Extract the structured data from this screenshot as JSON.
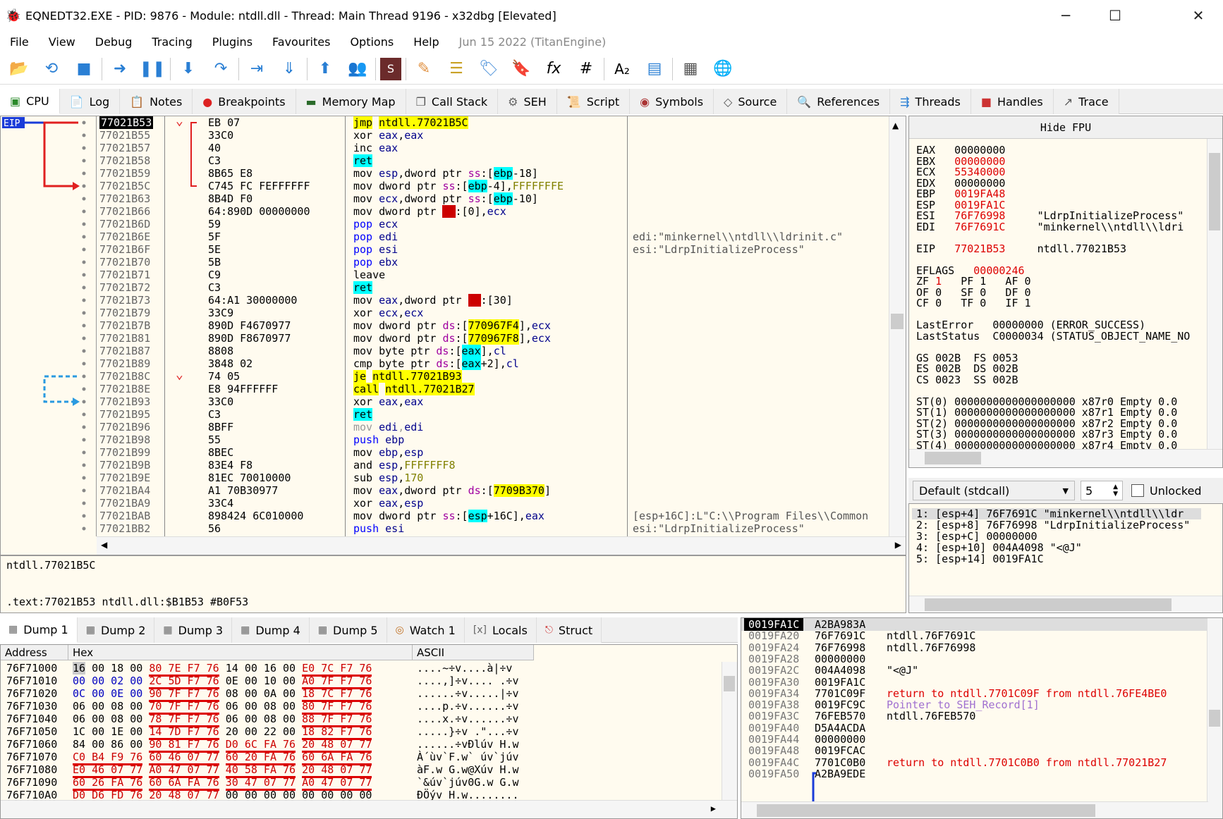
{
  "window": {
    "title": "EQNEDT32.EXE - PID: 9876 - Module: ntdll.dll - Thread: Main Thread 9196 - x32dbg [Elevated]",
    "minimize": "─",
    "maximize": "☐",
    "close": "✕"
  },
  "menu": {
    "items": [
      "File",
      "View",
      "Debug",
      "Tracing",
      "Plugins",
      "Favourites",
      "Options",
      "Help"
    ],
    "date": "Jun 15 2022 (TitanEngine)"
  },
  "toolbar": {
    "icons": [
      "open-icon",
      "restart-icon",
      "close-icon",
      "run-icon",
      "pause-icon",
      "step-into-icon",
      "step-over-icon",
      "trace-into-icon",
      "trace-over-icon",
      "execute-till-return-icon",
      "run-to-user-code-icon",
      "scylla-icon",
      "patch-icon",
      "comment-icon",
      "label-icon",
      "bookmark-icon",
      "function-icon",
      "hash-icon",
      "font-icon",
      "memory-map-icon",
      "calculator-icon",
      "globe-icon"
    ]
  },
  "tabs": [
    {
      "label": "CPU",
      "icon": "cpu-icon"
    },
    {
      "label": "Log",
      "icon": "log-icon"
    },
    {
      "label": "Notes",
      "icon": "notes-icon"
    },
    {
      "label": "Breakpoints",
      "icon": "breakpoint-icon"
    },
    {
      "label": "Memory Map",
      "icon": "memory-icon"
    },
    {
      "label": "Call Stack",
      "icon": "callstack-icon"
    },
    {
      "label": "SEH",
      "icon": "seh-icon"
    },
    {
      "label": "Script",
      "icon": "script-icon"
    },
    {
      "label": "Symbols",
      "icon": "symbols-icon"
    },
    {
      "label": "Source",
      "icon": "source-icon"
    },
    {
      "label": "References",
      "icon": "references-icon"
    },
    {
      "label": "Threads",
      "icon": "threads-icon"
    },
    {
      "label": "Handles",
      "icon": "handles-icon"
    },
    {
      "label": "Trace",
      "icon": "trace-icon"
    }
  ],
  "eip_label": "EIP",
  "disasm": [
    {
      "addr": "77021B53",
      "bytes": "EB 07",
      "ins": "jmp ntdll.77021B5C",
      "cmt": ""
    },
    {
      "addr": "77021B55",
      "bytes": "33C0",
      "ins": "xor eax,eax",
      "cmt": ""
    },
    {
      "addr": "77021B57",
      "bytes": "40",
      "ins": "inc eax",
      "cmt": ""
    },
    {
      "addr": "77021B58",
      "bytes": "C3",
      "ins": "ret",
      "cmt": ""
    },
    {
      "addr": "77021B59",
      "bytes": "8B65 E8",
      "ins": "mov esp,dword ptr ss:[ebp-18]",
      "cmt": ""
    },
    {
      "addr": "77021B5C",
      "bytes": "C745 FC FEFFFFFF",
      "ins": "mov dword ptr ss:[ebp-4],FFFFFFFE",
      "cmt": ""
    },
    {
      "addr": "77021B63",
      "bytes": "8B4D F0",
      "ins": "mov ecx,dword ptr ss:[ebp-10]",
      "cmt": ""
    },
    {
      "addr": "77021B66",
      "bytes": "64:890D 00000000",
      "ins": "mov dword ptr fs:[0],ecx",
      "cmt": ""
    },
    {
      "addr": "77021B6D",
      "bytes": "59",
      "ins": "pop ecx",
      "cmt": ""
    },
    {
      "addr": "77021B6E",
      "bytes": "5F",
      "ins": "pop edi",
      "cmt": "edi:\"minkernel\\\\ntdll\\\\ldrinit.c\""
    },
    {
      "addr": "77021B6F",
      "bytes": "5E",
      "ins": "pop esi",
      "cmt": "esi:\"LdrpInitializeProcess\""
    },
    {
      "addr": "77021B70",
      "bytes": "5B",
      "ins": "pop ebx",
      "cmt": ""
    },
    {
      "addr": "77021B71",
      "bytes": "C9",
      "ins": "leave",
      "cmt": ""
    },
    {
      "addr": "77021B72",
      "bytes": "C3",
      "ins": "ret",
      "cmt": ""
    },
    {
      "addr": "77021B73",
      "bytes": "64:A1 30000000",
      "ins": "mov eax,dword ptr fs:[30]",
      "cmt": ""
    },
    {
      "addr": "77021B79",
      "bytes": "33C9",
      "ins": "xor ecx,ecx",
      "cmt": ""
    },
    {
      "addr": "77021B7B",
      "bytes": "890D F4670977",
      "ins": "mov dword ptr ds:[770967F4],ecx",
      "cmt": ""
    },
    {
      "addr": "77021B81",
      "bytes": "890D F8670977",
      "ins": "mov dword ptr ds:[770967F8],ecx",
      "cmt": ""
    },
    {
      "addr": "77021B87",
      "bytes": "8808",
      "ins": "mov byte ptr ds:[eax],cl",
      "cmt": ""
    },
    {
      "addr": "77021B89",
      "bytes": "3848 02",
      "ins": "cmp byte ptr ds:[eax+2],cl",
      "cmt": ""
    },
    {
      "addr": "77021B8C",
      "bytes": "74 05",
      "ins": "je ntdll.77021B93",
      "cmt": ""
    },
    {
      "addr": "77021B8E",
      "bytes": "E8 94FFFFFF",
      "ins": "call ntdll.77021B27",
      "cmt": ""
    },
    {
      "addr": "77021B93",
      "bytes": "33C0",
      "ins": "xor eax,eax",
      "cmt": ""
    },
    {
      "addr": "77021B95",
      "bytes": "C3",
      "ins": "ret",
      "cmt": ""
    },
    {
      "addr": "77021B96",
      "bytes": "8BFF",
      "ins": "mov edi,edi",
      "cmt": ""
    },
    {
      "addr": "77021B98",
      "bytes": "55",
      "ins": "push ebp",
      "cmt": ""
    },
    {
      "addr": "77021B99",
      "bytes": "8BEC",
      "ins": "mov ebp,esp",
      "cmt": ""
    },
    {
      "addr": "77021B9B",
      "bytes": "83E4 F8",
      "ins": "and esp,FFFFFFF8",
      "cmt": ""
    },
    {
      "addr": "77021B9E",
      "bytes": "81EC 70010000",
      "ins": "sub esp,170",
      "cmt": ""
    },
    {
      "addr": "77021BA4",
      "bytes": "A1 70B30977",
      "ins": "mov eax,dword ptr ds:[7709B370]",
      "cmt": ""
    },
    {
      "addr": "77021BA9",
      "bytes": "33C4",
      "ins": "xor eax,esp",
      "cmt": ""
    },
    {
      "addr": "77021BAB",
      "bytes": "898424 6C010000",
      "ins": "mov dword ptr ss:[esp+16C],eax",
      "cmt": "[esp+16C]:L\"C:\\\\Program Files\\\\Common"
    },
    {
      "addr": "77021BB2",
      "bytes": "56",
      "ins": "push esi",
      "cmt": "esi:\"LdrpInitializeProcess\""
    }
  ],
  "info": {
    "line1": "ntdll.77021B5C",
    "line2": ".text:77021B53 ntdll.dll:$B1B53 #B0F53"
  },
  "regs": {
    "header": "Hide FPU",
    "lines": [
      "EAX   00000000",
      "EBX   00000000",
      "ECX   55340000",
      "EDX   00000000",
      "EBP   0019FA48",
      "ESP   0019FA1C",
      "ESI   76F76998     \"LdrpInitializeProcess\"",
      "EDI   76F7691C     \"minkernel\\\\ntdll\\\\ldri",
      "",
      "EIP   77021B53     ntdll.77021B53",
      "",
      "EFLAGS   00000246",
      "ZF 1   PF 1   AF 0",
      "OF 0   SF 0   DF 0",
      "CF 0   TF 0   IF 1",
      "",
      "LastError   00000000 (ERROR_SUCCESS)",
      "LastStatus  C0000034 (STATUS_OBJECT_NAME_NO",
      "",
      "GS 002B  FS 0053",
      "ES 002B  DS 002B",
      "CS 0023  SS 002B",
      "",
      "ST(0) 0000000000000000000 x87r0 Empty 0.0",
      "ST(1) 0000000000000000000 x87r1 Empty 0.0",
      "ST(2) 0000000000000000000 x87r2 Empty 0.0",
      "ST(3) 0000000000000000000 x87r3 Empty 0.0",
      "ST(4) 0000000000000000000 x87r4 Empty 0.0"
    ]
  },
  "callconv": {
    "selected": "Default (stdcall)",
    "count": "5",
    "unlocked": "Unlocked"
  },
  "stackargs": [
    "1: [esp+4] 76F7691C \"minkernel\\\\ntdll\\\\ldr",
    "2: [esp+8] 76F76998 \"LdrpInitializeProcess\"",
    "3: [esp+C] 00000000",
    "4: [esp+10] 004A4098 \"<@J\"",
    "5: [esp+14] 0019FA1C"
  ],
  "dump_tabs": [
    {
      "label": "Dump 1",
      "icon": "dump-icon"
    },
    {
      "label": "Dump 2",
      "icon": "dump-icon"
    },
    {
      "label": "Dump 3",
      "icon": "dump-icon"
    },
    {
      "label": "Dump 4",
      "icon": "dump-icon"
    },
    {
      "label": "Dump 5",
      "icon": "dump-icon"
    },
    {
      "label": "Watch 1",
      "icon": "watch-icon"
    },
    {
      "label": "Locals",
      "icon": "locals-icon"
    },
    {
      "label": "Struct",
      "icon": "struct-icon"
    }
  ],
  "dump_headers": {
    "address": "Address",
    "hex": "Hex",
    "ascii": "ASCII"
  },
  "dump_rows": [
    {
      "addr": "76F71000",
      "hex": "16 00 18 00 80 7E F7 76 14 00 16 00 E0 7C F7 76",
      "ascii": "....~÷v....à|÷v"
    },
    {
      "addr": "76F71010",
      "hex": "00 00 02 00 2C 5D F7 76 0E 00 10 00 A0 7F F7 76",
      "ascii": "....,]÷v.... .÷v"
    },
    {
      "addr": "76F71020",
      "hex": "0C 00 0E 00 90 7F F7 76 08 00 0A 00 18 7C F7 76",
      "ascii": "......÷v.....|÷v"
    },
    {
      "addr": "76F71030",
      "hex": "06 00 08 00 70 7F F7 76 06 00 08 00 80 7F F7 76",
      "ascii": "....p.÷v......÷v"
    },
    {
      "addr": "76F71040",
      "hex": "06 00 08 00 78 7F F7 76 06 00 08 00 88 7F F7 76",
      "ascii": "....x.÷v......÷v"
    },
    {
      "addr": "76F71050",
      "hex": "1C 00 1E 00 14 7D F7 76 20 00 22 00 18 82 F7 76",
      "ascii": ".....}÷v .\"...÷v"
    },
    {
      "addr": "76F71060",
      "hex": "84 00 86 00 90 81 F7 76 D0 6C FA 76 20 48 07 77",
      "ascii": "......÷vÐlúv H.w"
    },
    {
      "addr": "76F71070",
      "hex": "C0 B4 F9 76 60 46 07 77 60 20 FA 76 60 6A FA 76",
      "ascii": "À´ùv`F.w` úv`júv"
    },
    {
      "addr": "76F71080",
      "hex": "E0 46 07 77 A0 47 07 77 40 58 FA 76 20 48 07 77",
      "ascii": "àF.w G.w@Xúv H.w"
    },
    {
      "addr": "76F71090",
      "hex": "60 26 FA 76 60 6A FA 76 30 47 07 77 A0 47 07 77",
      "ascii": "`&úv`júv0G.w G.w"
    },
    {
      "addr": "76F710A0",
      "hex": "D0 D6 FD 76 20 48 07 77 00 00 00 00 00 00 00 00",
      "ascii": "ÐÖýv H.w........"
    }
  ],
  "stack_rows": [
    {
      "addr": "0019FA1C",
      "val": "A2BA983A",
      "cmt": "",
      "kind": "cur"
    },
    {
      "addr": "0019FA20",
      "val": "76F7691C",
      "cmt": "ntdll.76F7691C",
      "kind": ""
    },
    {
      "addr": "0019FA24",
      "val": "76F76998",
      "cmt": "ntdll.76F76998",
      "kind": ""
    },
    {
      "addr": "0019FA28",
      "val": "00000000",
      "cmt": "",
      "kind": ""
    },
    {
      "addr": "0019FA2C",
      "val": "004A4098",
      "cmt": "\"<@J\"",
      "kind": ""
    },
    {
      "addr": "0019FA30",
      "val": "0019FA1C",
      "cmt": "",
      "kind": ""
    },
    {
      "addr": "0019FA34",
      "val": "7701C09F",
      "cmt": "return to ntdll.7701C09F from ntdll.76FE4BE0",
      "kind": "ret"
    },
    {
      "addr": "0019FA38",
      "val": "0019FC9C",
      "cmt": "Pointer to SEH_Record[1]",
      "kind": "seh"
    },
    {
      "addr": "0019FA3C",
      "val": "76FEB570",
      "cmt": "ntdll.76FEB570",
      "kind": ""
    },
    {
      "addr": "0019FA40",
      "val": "D5A4ACDA",
      "cmt": "",
      "kind": ""
    },
    {
      "addr": "0019FA44",
      "val": "00000000",
      "cmt": "",
      "kind": ""
    },
    {
      "addr": "0019FA48",
      "val": "0019FCAC",
      "cmt": "",
      "kind": ""
    },
    {
      "addr": "0019FA4C",
      "val": "7701C0B0",
      "cmt": "return to ntdll.7701C0B0 from ntdll.77021B27",
      "kind": "ret"
    },
    {
      "addr": "0019FA50",
      "val": "A2BA9EDE",
      "cmt": "",
      "kind": ""
    }
  ],
  "colors": {
    "accent_red": "#cc0000",
    "highlight_yellow": "#ffff00",
    "highlight_cyan": "#00ffff",
    "panel_bg": "#fffbef"
  }
}
